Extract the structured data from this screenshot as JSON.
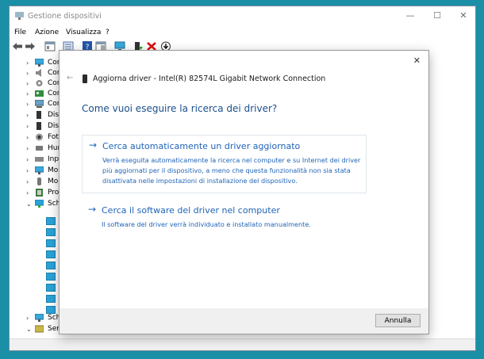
{
  "window": {
    "title": "Gestione dispositivi",
    "minimize_glyph": "—",
    "maximize_glyph": "☐",
    "close_glyph": "✕"
  },
  "menu": [
    "File",
    "Azione",
    "Visualizza",
    "?"
  ],
  "toolbar_icons": [
    "back-arrow-icon",
    "forward-arrow-icon",
    "properties-icon",
    "list-view-icon",
    "help-icon",
    "panel-icon",
    "monitor-scan-icon",
    "update-driver-icon",
    "uninstall-icon",
    "download-icon"
  ],
  "tree": {
    "items": [
      {
        "label": "Con",
        "chevron": "›",
        "icon": "monitor-icon"
      },
      {
        "label": "Con",
        "chevron": "›",
        "icon": "speaker-icon"
      },
      {
        "label": "Con",
        "chevron": "›",
        "icon": "gear-icon"
      },
      {
        "label": "Con",
        "chevron": "›",
        "icon": "board-icon"
      },
      {
        "label": "Con",
        "chevron": "›",
        "icon": "computer-icon"
      },
      {
        "label": "Disp",
        "chevron": "›",
        "icon": "device-icon"
      },
      {
        "label": "Disp",
        "chevron": "›",
        "icon": "device-icon"
      },
      {
        "label": "Foto",
        "chevron": "›",
        "icon": "camera-icon"
      },
      {
        "label": "Hum",
        "chevron": "›",
        "icon": "hid-icon"
      },
      {
        "label": "Inpu",
        "chevron": "›",
        "icon": "keyboard-icon"
      },
      {
        "label": "Mo",
        "chevron": "›",
        "icon": "monitor-icon"
      },
      {
        "label": "Mo",
        "chevron": "›",
        "icon": "mouse-icon"
      },
      {
        "label": "Pro",
        "chevron": "›",
        "icon": "processor-icon"
      },
      {
        "label": "Sch",
        "chevron": "⌄",
        "icon": "network-icon"
      }
    ],
    "tail": [
      {
        "label": "Sch",
        "chevron": "›",
        "icon": "display-adapter-icon"
      },
      {
        "label": "Sen",
        "chevron": "⌄",
        "icon": "sensor-icon"
      }
    ]
  },
  "dialog": {
    "close_glyph": "✕",
    "back_glyph": "←",
    "header": "Aggiorna driver - Intel(R) 82574L Gigabit Network Connection",
    "question": "Come vuoi eseguire la ricerca dei driver?",
    "option1": {
      "arrow": "→",
      "title": "Cerca automaticamente un driver aggiornato",
      "description": "Verrà eseguita automaticamente la ricerca nel computer e su Internet dei driver più aggiornati per il dispositivo, a meno che questa funzionalità non sia stata disattivata nelle impostazioni di installazione del dispositivo."
    },
    "option2": {
      "arrow": "→",
      "title": "Cerca il software del driver nel computer",
      "description": "Il software del driver verrà individuato e installato manualmente."
    },
    "cancel_label": "Annulla"
  },
  "colors": {
    "desktop": "#1a8fa6",
    "link": "#1f64b7",
    "question": "#1a4e8a"
  }
}
